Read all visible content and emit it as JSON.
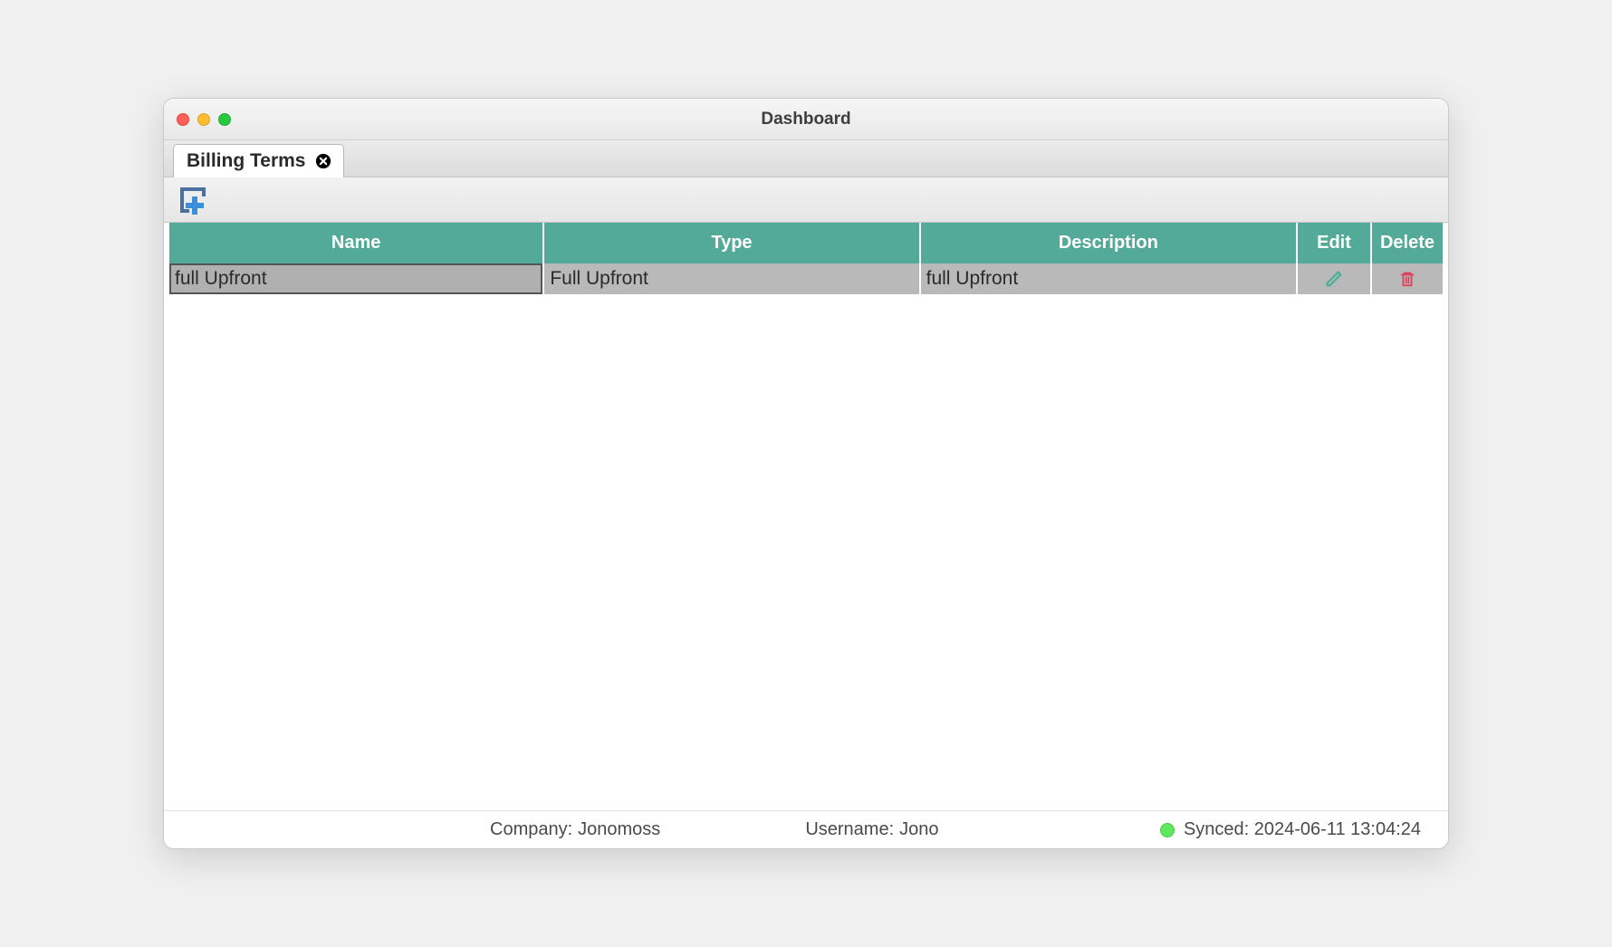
{
  "window": {
    "title": "Dashboard"
  },
  "tabs": [
    {
      "label": "Billing Terms"
    }
  ],
  "table": {
    "columns": {
      "name": "Name",
      "type": "Type",
      "description": "Description",
      "edit": "Edit",
      "delete": "Delete"
    },
    "rows": [
      {
        "name": "full Upfront",
        "type": "Full Upfront",
        "description": "full Upfront"
      }
    ]
  },
  "status": {
    "company_label": "Company: ",
    "company_value": "Jonomoss",
    "username_label": "Username: ",
    "username_value": "Jono",
    "synced_label": "Synced: ",
    "synced_value": "2024-06-11 13:04:24",
    "sync_color": "#5ee85e"
  },
  "colors": {
    "header_bg": "#54aa98",
    "row_bg": "#b9b9b9",
    "edit_icon": "#4fb09a",
    "delete_icon": "#d9455f"
  }
}
